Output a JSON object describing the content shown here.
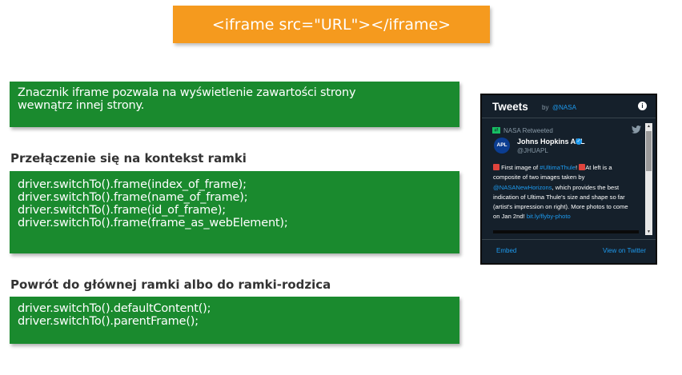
{
  "title": "<iframe src=\"URL\"></iframe>",
  "description_lines": [
    "Znacznik iframe pozwala na wyświetlenie zawartości strony",
    "wewnątrz innej strony."
  ],
  "switch_section": {
    "heading": "Przełączenie się na kontekst ramki",
    "code_lines": [
      "driver.switchTo().frame(index_of_frame);",
      "driver.switchTo().frame(name_of_frame);",
      "driver.switchTo().frame(id_of_frame);",
      "driver.switchTo().frame(frame_as_webElement);"
    ]
  },
  "return_section": {
    "heading": "Powrót do głównej ramki albo do ramki-rodzica",
    "code_lines": [
      "driver.switchTo().defaultContent();",
      "driver.switchTo().parentFrame();"
    ]
  },
  "tweet_widget": {
    "title": "Tweets",
    "by": "by",
    "account": "@NASA",
    "info_icon": "i",
    "retweeted_label": "NASA Retweeted",
    "author_name": "Johns Hopkins APL",
    "author_handle": "@JHUAPL",
    "avatar_text": "APL",
    "tweet": {
      "t1": "First image of ",
      "link1": "#UltimaThule",
      "t2": "! ",
      "t3": "At left is a composite of two images taken by ",
      "link2": "@NASANewHorizons",
      "t4": ", which provides the best indication of Ultima Thule's size and shape so far (artist's impression on right). More photos to come on Jan 2nd! ",
      "link3": "bit.ly/flyby-photo"
    },
    "embed_label": "Embed",
    "view_label": "View on Twitter"
  },
  "colors": {
    "banner": "#f59a1e",
    "green": "#1a8a2e",
    "widget_bg": "#15202b",
    "link": "#1d9bf0"
  }
}
